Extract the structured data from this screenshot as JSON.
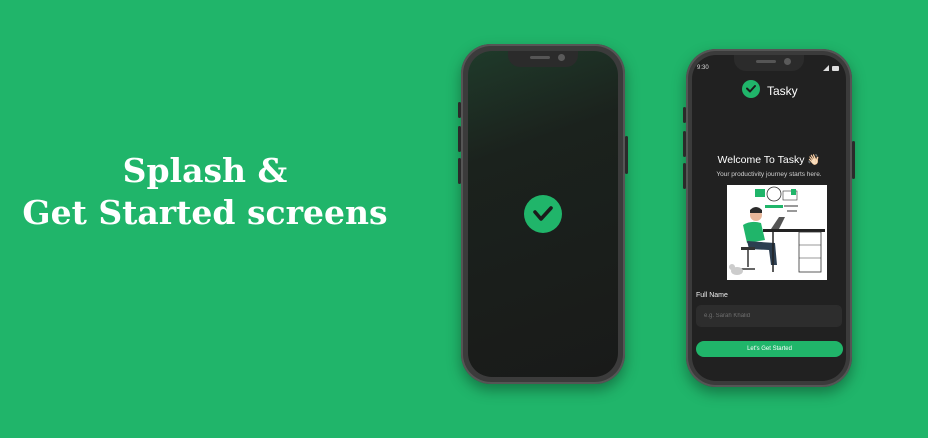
{
  "headline": {
    "line1": "Splash &",
    "line2": "Get Started screens"
  },
  "colors": {
    "background": "#20b56a",
    "accent": "#20b56a",
    "screen_dark": "#212121"
  },
  "splash": {
    "logo_icon": "tasky-check-logo-icon"
  },
  "get_started": {
    "status_time": "9:30",
    "status_icons": "wifi-signal-battery",
    "app_name": "Tasky",
    "welcome": "Welcome To Tasky 👋🏻",
    "tagline": "Your productivity journey starts here.",
    "illustration": "person-at-desk-illustration",
    "field_label": "Full Name",
    "field_placeholder": "e.g. Sarah Khalid",
    "field_value": "",
    "cta_label": "Let's Get Started"
  }
}
